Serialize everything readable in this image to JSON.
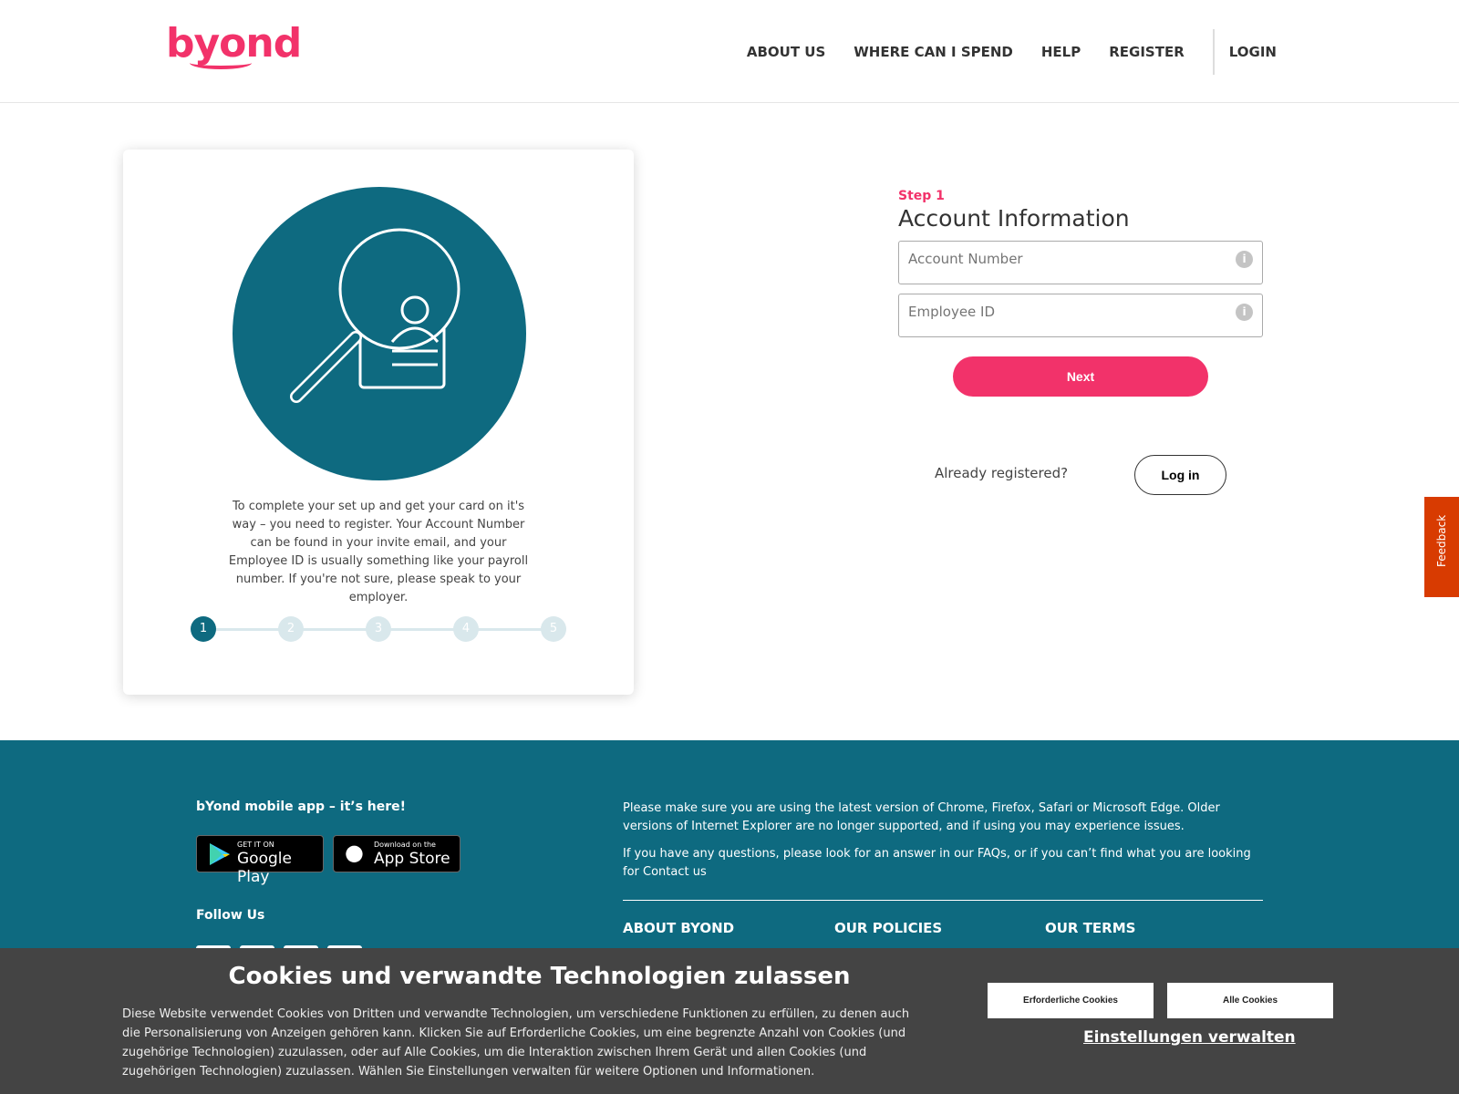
{
  "header": {
    "logo": "byond",
    "nav": [
      "ABOUT US",
      "WHERE CAN I SPEND",
      "HELP",
      "REGISTER"
    ],
    "login": "LOGIN"
  },
  "card": {
    "text": "To complete your set up and get your card on it's way – you need to register. Your Account Number can be found in your invite email, and your Employee ID is usually something like your payroll number. If you're not sure, please speak to your employer.",
    "steps": [
      "1",
      "2",
      "3",
      "4",
      "5"
    ],
    "active_step": 1
  },
  "form": {
    "step": "Step 1",
    "title": "Account Information",
    "account_placeholder": "Account Number",
    "employee_placeholder": "Employee ID",
    "next": "Next",
    "already": "Already registered?",
    "login": "Log in"
  },
  "feedback": "Feedback",
  "footer": {
    "app_title": "bYond mobile app – it’s here!",
    "google_small": "GET IT ON",
    "google_big": "Google Play",
    "apple_small": "Download on the",
    "apple_big": "App Store",
    "follow": "Follow Us",
    "info1": "Please make sure you are using the latest version of Chrome, Firefox, Safari or Microsoft Edge. Older versions of Internet Explorer are no longer supported, and if using you may experience issues.",
    "info2": "If you have any questions, please look for an answer in our FAQs, or if you can’t find what you are looking for Contact us",
    "headings": [
      "ABOUT BYOND",
      "OUR POLICIES",
      "OUR TERMS"
    ]
  },
  "cookie": {
    "title": "Cookies und verwandte Technologien zulassen",
    "text": "Diese Website verwendet Cookies von Dritten und verwandte Technologien, um verschiedene Funktionen zu erfüllen, zu denen auch die Personalisierung von Anzeigen gehören kann. Klicken Sie auf Erforderliche Cookies, um eine begrenzte Anzahl von Cookies (und zugehörige Technologien) zuzulassen, oder auf Alle Cookies, um die Interaktion zwischen Ihrem Gerät und allen Cookies (und zugehörigen Technologien) zuzulassen. Wählen Sie Einstellungen verwalten für weitere Optionen und Informationen.",
    "required": "Erforderliche Cookies",
    "all": "Alle Cookies",
    "manage": "Einstellungen verwalten"
  },
  "colors": {
    "brand": "#f2326a",
    "teal": "#0e6a80",
    "feedback": "#d83b01"
  }
}
